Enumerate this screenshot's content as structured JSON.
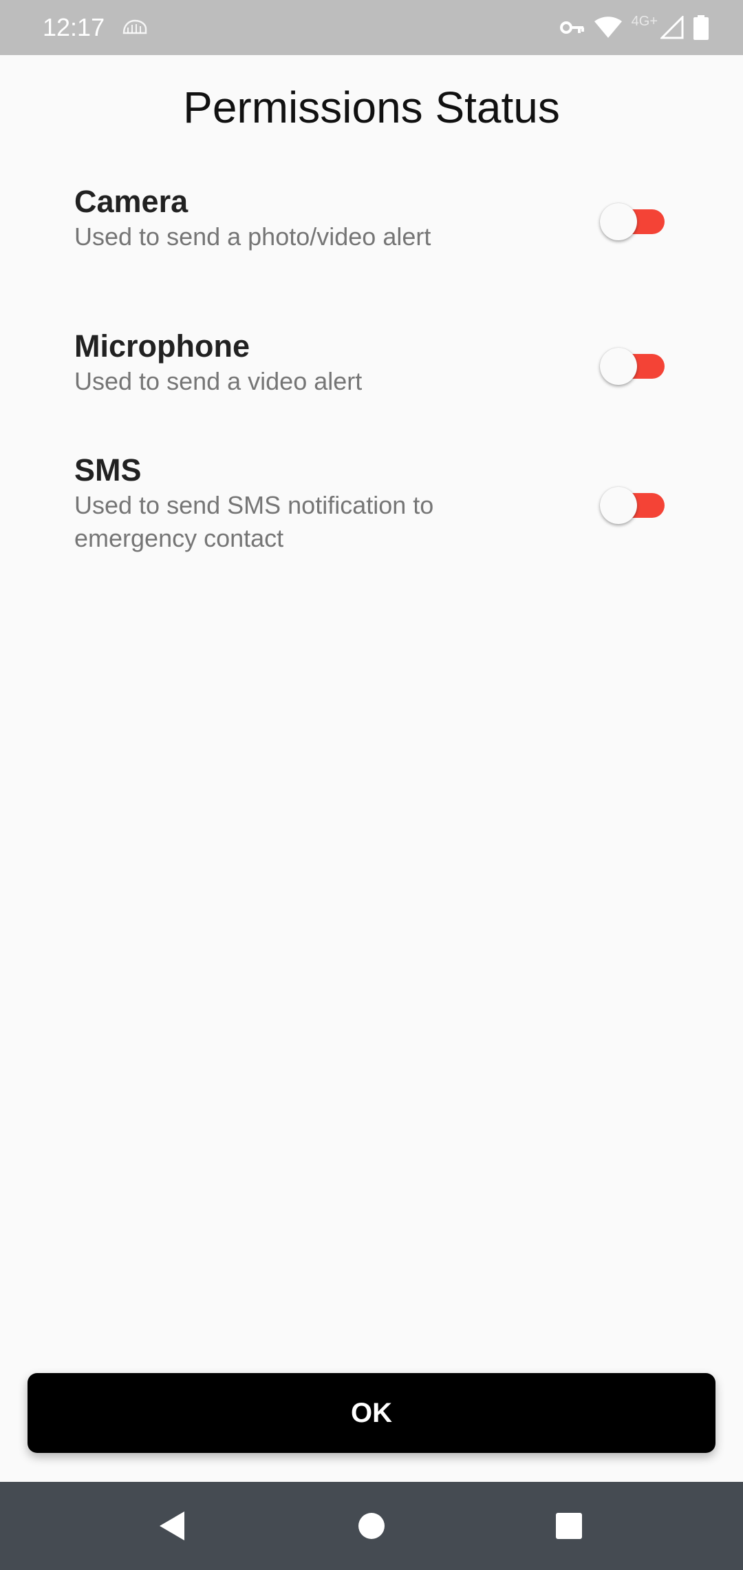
{
  "status_bar": {
    "time": "12:17",
    "network_label": "4G+",
    "icons": [
      "notification-icon",
      "vpn-key-icon",
      "wifi-icon",
      "signal-icon",
      "battery-icon"
    ]
  },
  "title": "Permissions Status",
  "permissions": [
    {
      "name": "Camera",
      "description": "Used to send a photo/video alert",
      "enabled": false
    },
    {
      "name": "Microphone",
      "description": "Used to send a video alert",
      "enabled": false
    },
    {
      "name": "SMS",
      "description": "Used to send SMS notification to emergency contact",
      "enabled": false
    }
  ],
  "ok_button": {
    "label": "OK"
  },
  "colors": {
    "status_bar": "#bdbdbd",
    "toggle_track": "#f44336",
    "toggle_thumb": "#fafafa",
    "button_bg": "#000000",
    "nav_bar": "#454b52"
  },
  "nav_bar": {
    "buttons": [
      "back-icon",
      "home-icon",
      "recents-icon"
    ]
  }
}
